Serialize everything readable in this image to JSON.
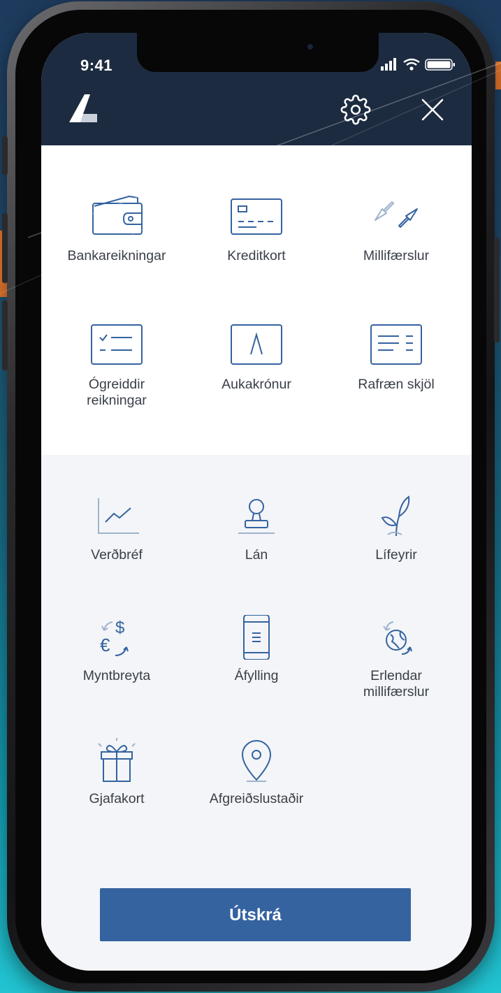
{
  "status_bar": {
    "time": "9:41"
  },
  "header": {
    "logo": "bank-logo",
    "icons": [
      "settings-icon",
      "close-icon"
    ],
    "background_color": "#1c2b40"
  },
  "menu": {
    "primary_items": [
      {
        "label": "Bankareikningar",
        "icon": "wallet-icon"
      },
      {
        "label": "Kreditkort",
        "icon": "credit-card-icon"
      },
      {
        "label": "Millifærslur",
        "icon": "transfer-arrows-icon"
      },
      {
        "label": "Ógreiddir\nreikningar",
        "icon": "checklist-icon"
      },
      {
        "label": "Aukakrónur",
        "icon": "aukakronur-card-icon"
      },
      {
        "label": "Rafræn skjöl",
        "icon": "document-icon"
      }
    ],
    "secondary_items": [
      {
        "label": "Verðbréf",
        "icon": "line-chart-icon"
      },
      {
        "label": "Lán",
        "icon": "stamp-icon"
      },
      {
        "label": "Lífeyrir",
        "icon": "sprout-icon"
      },
      {
        "label": "Myntbreyta",
        "icon": "currency-exchange-icon"
      },
      {
        "label": "Áfylling",
        "icon": "phone-topup-icon"
      },
      {
        "label": "Erlendar\nmillifærslur",
        "icon": "globe-transfer-icon"
      },
      {
        "label": "Gjafakort",
        "icon": "gift-icon"
      },
      {
        "label": "Afgreiðslustaðir",
        "icon": "location-pin-icon"
      }
    ]
  },
  "logout_button": {
    "label": "Útskrá",
    "color": "#3563a0"
  },
  "colors": {
    "icon_stroke": "#3563a0",
    "label_text": "#3a3f48",
    "orange_accent": "#e4762c"
  }
}
